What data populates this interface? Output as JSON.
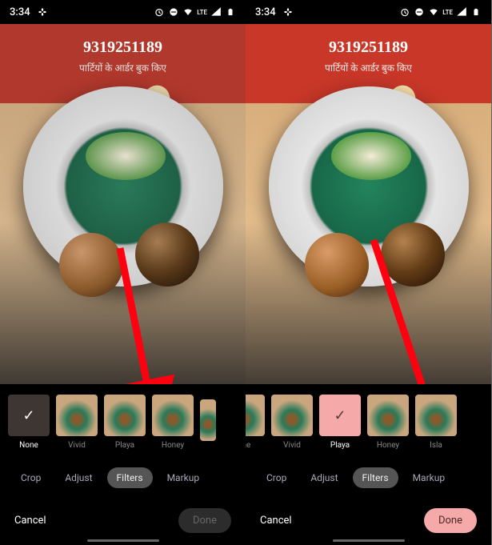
{
  "status": {
    "time": "3:34",
    "carrier_label": "LTE"
  },
  "preview": {
    "sign_number": "9319251189",
    "sign_sub": "पार्टियों के आर्डर बुक किए"
  },
  "left": {
    "filters": [
      {
        "label": "None",
        "active": true,
        "thumb": "check-none"
      },
      {
        "label": "Vivid",
        "active": false,
        "thumb": "photo"
      },
      {
        "label": "Playa",
        "active": false,
        "thumb": "photo"
      },
      {
        "label": "Honey",
        "active": false,
        "thumb": "photo"
      },
      {
        "label": "",
        "active": false,
        "thumb": "photo"
      }
    ],
    "tabs": {
      "crop": "Crop",
      "adjust": "Adjust",
      "filters": "Filters",
      "markup": "Markup"
    },
    "actions": {
      "cancel": "Cancel",
      "done": "Done",
      "done_enabled": false
    }
  },
  "right": {
    "filters": [
      {
        "label": "one",
        "active": false,
        "thumb": "photo"
      },
      {
        "label": "Vivid",
        "active": false,
        "thumb": "photo"
      },
      {
        "label": "Playa",
        "active": true,
        "thumb": "check-playa"
      },
      {
        "label": "Honey",
        "active": false,
        "thumb": "photo"
      },
      {
        "label": "Isla",
        "active": false,
        "thumb": "photo"
      }
    ],
    "tabs": {
      "crop": "Crop",
      "adjust": "Adjust",
      "filters": "Filters",
      "markup": "Markup"
    },
    "actions": {
      "cancel": "Cancel",
      "done": "Done",
      "done_enabled": true
    }
  }
}
